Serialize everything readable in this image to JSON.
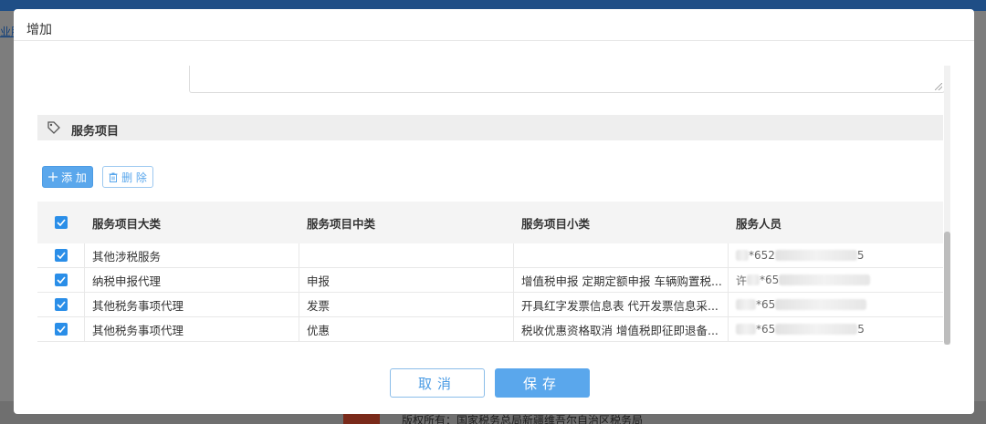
{
  "background": {
    "link_text": "业服",
    "footer_text": "版权所有：国家税务总局新疆维吾尔自治区税务局"
  },
  "dialog": {
    "title": "增加",
    "section_title": "服务项目",
    "add_label": "添 加",
    "delete_label": "删 除",
    "cancel_label": "取消",
    "save_label": "保存"
  },
  "table": {
    "headers": [
      "服务项目大类",
      "服务项目中类",
      "服务项目小类",
      "服务人员"
    ],
    "rows": [
      {
        "checked": true,
        "major": "其他涉税服务",
        "middle": "",
        "minor": "",
        "person_start": "",
        "person_code": "*652",
        "person_end": "5"
      },
      {
        "checked": true,
        "major": "纳税申报代理",
        "middle": "申报",
        "minor": "增值税申报 定期定额申报 车辆购置税...",
        "person_start": "许",
        "person_code": "*65",
        "person_end": ""
      },
      {
        "checked": true,
        "major": "其他税务事项代理",
        "middle": "发票",
        "minor": "开具红字发票信息表 代开发票信息采...",
        "person_start": "",
        "person_code": "*65",
        "person_end": ""
      },
      {
        "checked": true,
        "major": "其他税务事项代理",
        "middle": "优惠",
        "minor": "税收优惠资格取消 增值税即征即退备...",
        "person_start": "",
        "person_code": "*65",
        "person_end": "5"
      }
    ]
  },
  "colors": {
    "primary": "#5aa7ec",
    "checkbox": "#2a8ee8",
    "overlay": "#7d7d7d"
  },
  "icons": [
    "tag-icon",
    "plus-icon",
    "trash-icon",
    "check-icon",
    "resize-grip-icon"
  ]
}
